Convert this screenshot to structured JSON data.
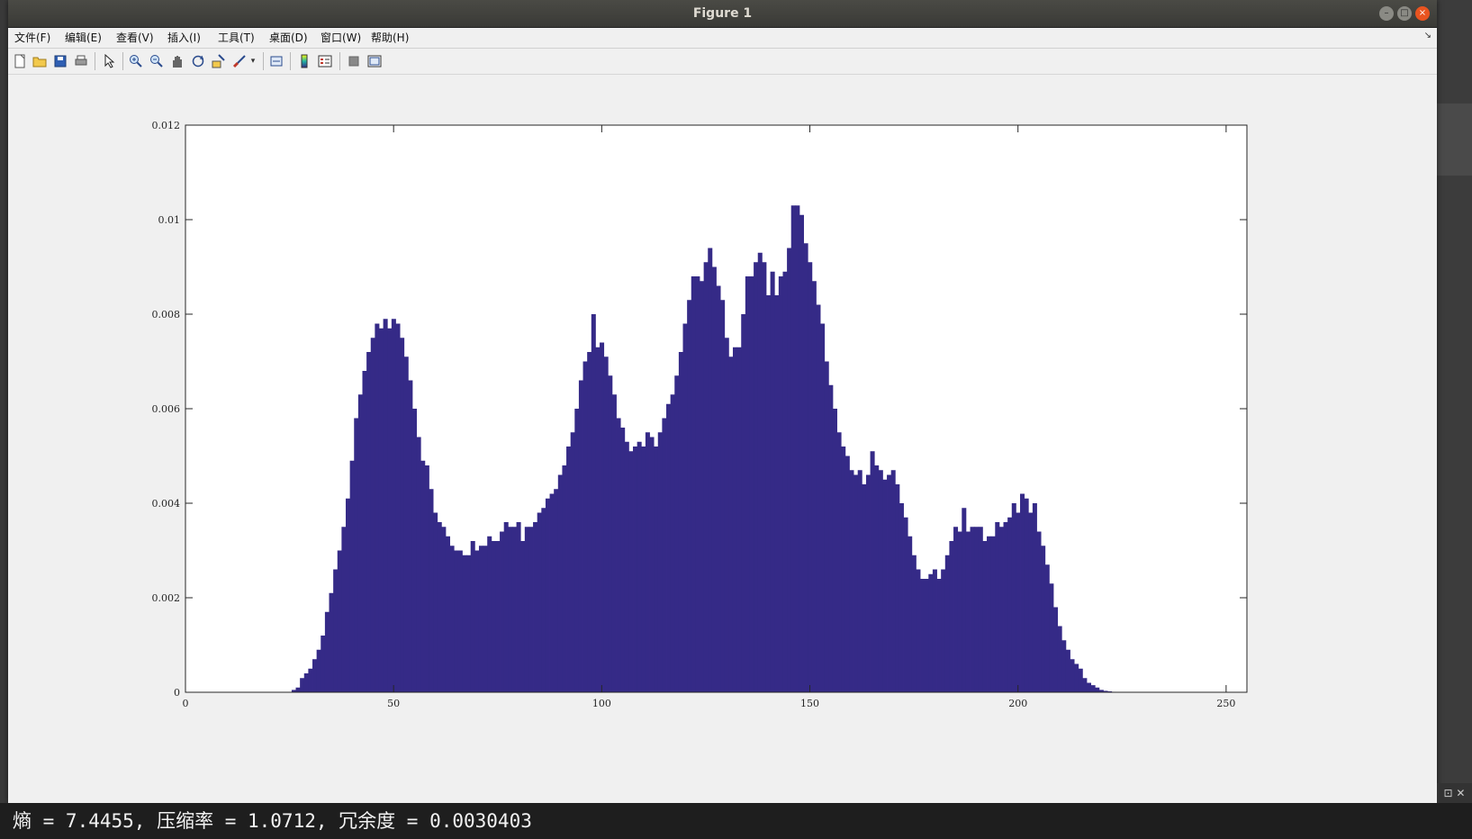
{
  "window": {
    "title": "Figure 1",
    "controls": [
      "–",
      "□",
      "×"
    ]
  },
  "menu": {
    "items": [
      "文件(F)",
      "编辑(E)",
      "查看(V)",
      "插入(I)",
      "工具(T)",
      "桌面(D)",
      "窗口(W)",
      "帮助(H)"
    ],
    "overflow_icon": "chevron-icon"
  },
  "toolbar": {
    "icons": [
      "new-figure-icon",
      "open-icon",
      "save-icon",
      "print-icon",
      "pointer-icon",
      "zoom-in-icon",
      "zoom-out-icon",
      "pan-icon",
      "rotate-icon",
      "data-cursor-icon",
      "brush-icon",
      "brush-dropdown-icon",
      "link-plot-icon",
      "colorbar-icon",
      "legend-icon",
      "hide-tools-icon",
      "show-tools-icon"
    ]
  },
  "status": {
    "text": "熵 = 7.4455, 压缩率 = 1.0712, 冗余度 = 0.0030403"
  },
  "chart_data": {
    "type": "bar",
    "bar_color": "#352a87",
    "xlim": [
      0,
      255
    ],
    "ylim": [
      0,
      0.012
    ],
    "xticks": [
      0,
      50,
      100,
      150,
      200,
      250
    ],
    "yticks": [
      0,
      0.002,
      0.004,
      0.006,
      0.008,
      0.01,
      0.012
    ],
    "xtick_labels": [
      "0",
      "50",
      "100",
      "150",
      "200",
      "250"
    ],
    "ytick_labels": [
      "0",
      "0.002",
      "0.004",
      "0.006",
      "0.008",
      "0.01",
      "0.012"
    ],
    "grid": false,
    "x_start": 0,
    "values": [
      0,
      0,
      0,
      0,
      0,
      0,
      0,
      0,
      0,
      0,
      0,
      0,
      0,
      0,
      0,
      0,
      0,
      0,
      0,
      0,
      0,
      0,
      0,
      0,
      0,
      0,
      5e-05,
      0.0001,
      0.0003,
      0.0004,
      0.0005,
      0.0007,
      0.0009,
      0.0012,
      0.0017,
      0.0021,
      0.0026,
      0.003,
      0.0035,
      0.0041,
      0.0049,
      0.0058,
      0.0063,
      0.0068,
      0.0072,
      0.0075,
      0.0078,
      0.0077,
      0.0079,
      0.0077,
      0.0079,
      0.0078,
      0.0075,
      0.0071,
      0.0066,
      0.006,
      0.0054,
      0.0049,
      0.0048,
      0.0043,
      0.0038,
      0.0036,
      0.0035,
      0.0033,
      0.0031,
      0.003,
      0.003,
      0.0029,
      0.0029,
      0.0032,
      0.003,
      0.0031,
      0.0031,
      0.0033,
      0.0032,
      0.0032,
      0.0034,
      0.0036,
      0.0035,
      0.0035,
      0.0036,
      0.0032,
      0.0035,
      0.0035,
      0.0036,
      0.0038,
      0.0039,
      0.0041,
      0.0042,
      0.0043,
      0.0046,
      0.0048,
      0.0052,
      0.0055,
      0.006,
      0.0066,
      0.007,
      0.0072,
      0.008,
      0.0073,
      0.0074,
      0.0071,
      0.0067,
      0.0063,
      0.0058,
      0.0056,
      0.0053,
      0.0051,
      0.0052,
      0.0053,
      0.0052,
      0.0055,
      0.0054,
      0.0052,
      0.0055,
      0.0058,
      0.0061,
      0.0063,
      0.0067,
      0.0072,
      0.0078,
      0.0083,
      0.0088,
      0.0088,
      0.0087,
      0.0091,
      0.0094,
      0.009,
      0.0086,
      0.0083,
      0.0075,
      0.0071,
      0.0073,
      0.0073,
      0.008,
      0.0088,
      0.0088,
      0.0091,
      0.0093,
      0.0091,
      0.0084,
      0.0089,
      0.0084,
      0.0088,
      0.0089,
      0.0094,
      0.0103,
      0.0103,
      0.0101,
      0.0095,
      0.0091,
      0.0087,
      0.0082,
      0.0078,
      0.007,
      0.0065,
      0.006,
      0.0055,
      0.0052,
      0.005,
      0.0047,
      0.0046,
      0.0047,
      0.0044,
      0.0046,
      0.0051,
      0.0048,
      0.0047,
      0.0045,
      0.0046,
      0.0047,
      0.0044,
      0.004,
      0.0037,
      0.0033,
      0.0029,
      0.0026,
      0.0024,
      0.0024,
      0.0025,
      0.0026,
      0.0024,
      0.0026,
      0.0029,
      0.0032,
      0.0035,
      0.0034,
      0.0039,
      0.0034,
      0.0035,
      0.0035,
      0.0035,
      0.0032,
      0.0033,
      0.0033,
      0.0036,
      0.0035,
      0.0036,
      0.0037,
      0.004,
      0.0038,
      0.0042,
      0.0041,
      0.0038,
      0.004,
      0.0034,
      0.0031,
      0.0027,
      0.0023,
      0.0018,
      0.0014,
      0.0011,
      0.0009,
      0.0007,
      0.0006,
      0.0005,
      0.0003,
      0.0002,
      0.00015,
      0.0001,
      5e-05,
      3e-05,
      2e-05,
      1e-05,
      0,
      0,
      0,
      0,
      0,
      0,
      0,
      0,
      0,
      0,
      0,
      0,
      0,
      0,
      0,
      0,
      0,
      0,
      0,
      0,
      0,
      0,
      0
    ]
  }
}
